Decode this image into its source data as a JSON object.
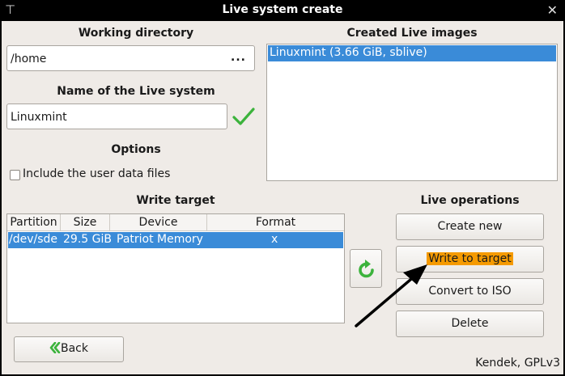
{
  "window": {
    "title": "Live system create",
    "pin_icon": "pin-icon",
    "close_icon": "close-icon"
  },
  "working_directory": {
    "label": "Working directory",
    "value": "/home",
    "browse_label": "..."
  },
  "live_name": {
    "label": "Name of the Live system",
    "value": "Linuxmint",
    "valid_icon": "checkmark-icon"
  },
  "options": {
    "label": "Options",
    "include_user_data": {
      "label": "Include the user data files",
      "checked": false
    }
  },
  "created_images": {
    "label": "Created Live images",
    "items": [
      "Linuxmint (3.66 GiB, sblive)"
    ]
  },
  "write_target": {
    "label": "Write target",
    "columns": [
      "Partition",
      "Size",
      "Device",
      "Format"
    ],
    "rows": [
      {
        "partition": "/dev/sde",
        "size": "29.5 GiB",
        "device": "Patriot Memory",
        "format": "x"
      }
    ]
  },
  "refresh_icon": "refresh-icon",
  "live_operations": {
    "label": "Live operations",
    "create_new": "Create new",
    "write_to_target": "Write to target",
    "convert_to_iso": "Convert to ISO",
    "delete": "Delete"
  },
  "back_button": {
    "label": "Back",
    "icon": "double-chevron-left-icon"
  },
  "footer": "Kendek, GPLv3",
  "colors": {
    "selection": "#3a8bd8",
    "highlight": "#f59a00",
    "checkmark": "#3cb33c",
    "refresh": "#3cb33c",
    "window_bg": "#efebe7"
  }
}
